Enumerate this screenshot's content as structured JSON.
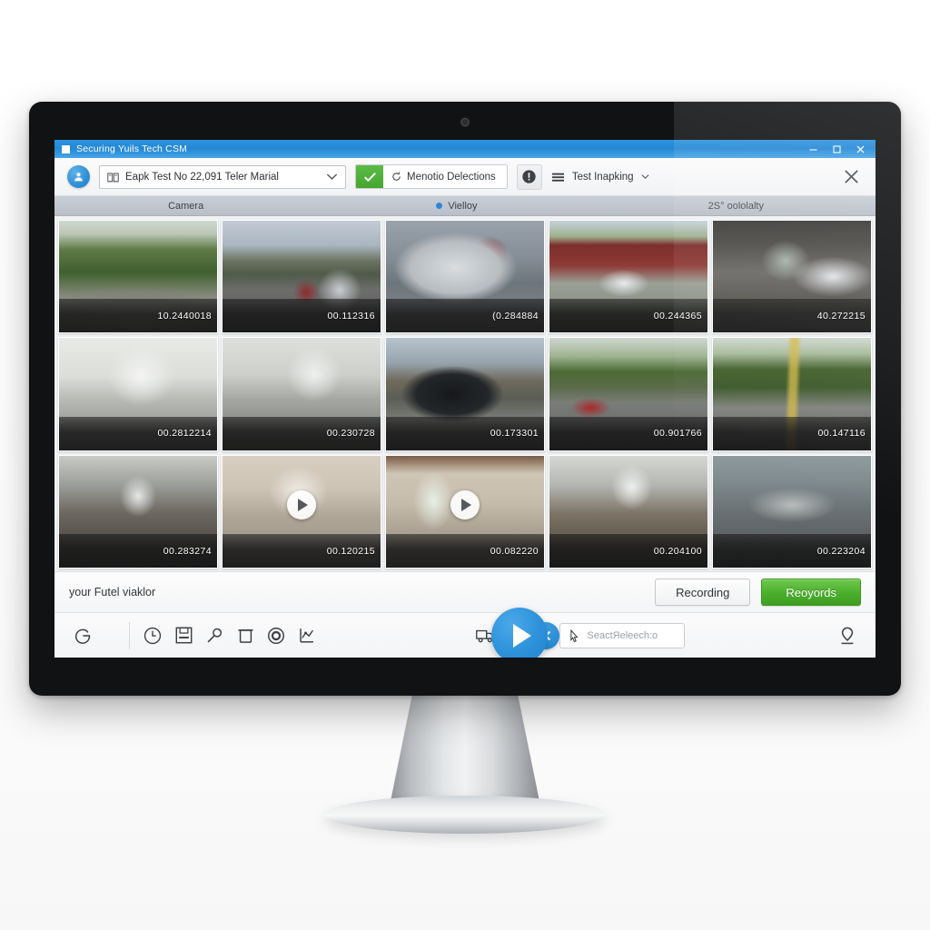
{
  "window": {
    "title": "Securing Yuils Tech CSM",
    "minimize_label": "–",
    "maximize_label": "□",
    "close_label": "✕"
  },
  "toolbar": {
    "avatar_icon": "user-avatar-icon",
    "account_selector": {
      "icon": "book-icon",
      "value": "Eapk Test No 22,091 Teler Marial",
      "chevron_icon": "chevron-down-icon"
    },
    "detections_chip": {
      "check_icon": "check-icon",
      "refresh_icon": "refresh-icon",
      "label": "Menotio Delections"
    },
    "alert_button_icon": "alert-circle-icon",
    "mapping_menu": {
      "icon": "list-icon",
      "label": "Test Inapking",
      "chevron_icon": "chevron-down-icon"
    },
    "close_icon": "close-icon"
  },
  "tabs": [
    {
      "label": "Camera",
      "active": false,
      "dot": false
    },
    {
      "label": "Vielloy",
      "active": true,
      "dot": true
    },
    {
      "label": "2S° oololalty",
      "active": false,
      "dot": false
    }
  ],
  "grid": {
    "rows": 3,
    "cols": 5,
    "thumbnails": [
      {
        "code": "10.2440018",
        "scene": "sc-road-trees",
        "play": false
      },
      {
        "code": "00.112316",
        "scene": "sc-road-cars",
        "play": false
      },
      {
        "code": "(0.284884",
        "scene": "sc-car-closeup",
        "play": false
      },
      {
        "code": "00.244365",
        "scene": "sc-house-red",
        "play": false
      },
      {
        "code": "40.272215",
        "scene": "sc-garage",
        "play": false
      },
      {
        "code": "00.2812214",
        "scene": "sc-hall-white",
        "play": false
      },
      {
        "code": "00.230728",
        "scene": "sc-hall-grey",
        "play": false
      },
      {
        "code": "00.173301",
        "scene": "sc-black-car",
        "play": false
      },
      {
        "code": "00.901766",
        "scene": "sc-red-car-road",
        "play": false
      },
      {
        "code": "00.147116",
        "scene": "sc-road-yellow",
        "play": false
      },
      {
        "code": "00.283274",
        "scene": "sc-hall-dark",
        "play": false
      },
      {
        "code": "00.120215",
        "scene": "sc-room-beige",
        "play": true
      },
      {
        "code": "00.082220",
        "scene": "sc-room-window",
        "play": true
      },
      {
        "code": "00.204100",
        "scene": "sc-hall-doors",
        "play": false
      },
      {
        "code": "00.223204",
        "scene": "sc-outdoor-shed",
        "play": false
      }
    ]
  },
  "statusbar": {
    "text": "your Futel viaklor",
    "recording_label": "Recording",
    "records_label": "Reoyords"
  },
  "bottombar": {
    "brand_icon": "g-logo-icon",
    "tools": [
      {
        "icon": "clock-icon"
      },
      {
        "icon": "save-icon"
      },
      {
        "icon": "key-icon"
      },
      {
        "icon": "trash-icon"
      },
      {
        "icon": "record-circle-icon"
      },
      {
        "icon": "chart-icon"
      }
    ],
    "play_icon": "play-icon",
    "right_tools": [
      {
        "icon": "truck-icon"
      },
      {
        "icon": "monitor-icon"
      }
    ],
    "x_badge_icon": "close-circle-icon",
    "search": {
      "icon": "cursor-click-icon",
      "placeholder": "SeactЯeleech:o"
    },
    "location_icon": "location-pin-icon"
  },
  "colors": {
    "title_blue": "#2387d4",
    "accent_blue": "#2e92da",
    "green": "#4cb02c",
    "tab_bar": "#c2c7cf"
  }
}
